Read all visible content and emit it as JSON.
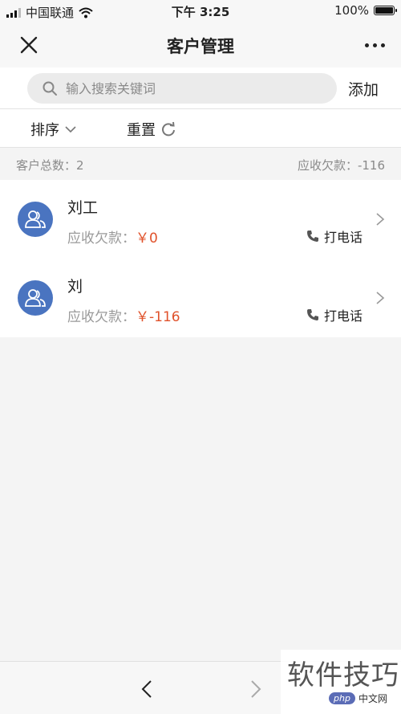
{
  "status_bar": {
    "carrier": "中国联通",
    "time": "下午 3:25",
    "battery": "100%"
  },
  "nav": {
    "title": "客户管理"
  },
  "search": {
    "placeholder": "输入搜索关键词",
    "value": "",
    "add_label": "添加"
  },
  "filters": {
    "sort_label": "排序",
    "reset_label": "重置"
  },
  "summary": {
    "total_label": "客户总数：2",
    "receivable_label": "应收欠款：-116"
  },
  "customers": [
    {
      "name": "刘工",
      "receivable_label": "应收欠款：",
      "amount": "￥0",
      "call_label": "打电话"
    },
    {
      "name": "刘",
      "receivable_label": "应收欠款：",
      "amount": "￥-116",
      "call_label": "打电话"
    }
  ],
  "watermark": {
    "text": "软件技巧",
    "logo_php": "php",
    "logo_site": "中文网"
  },
  "colors": {
    "avatar": "#4a74c0",
    "amount": "#e0522b"
  }
}
